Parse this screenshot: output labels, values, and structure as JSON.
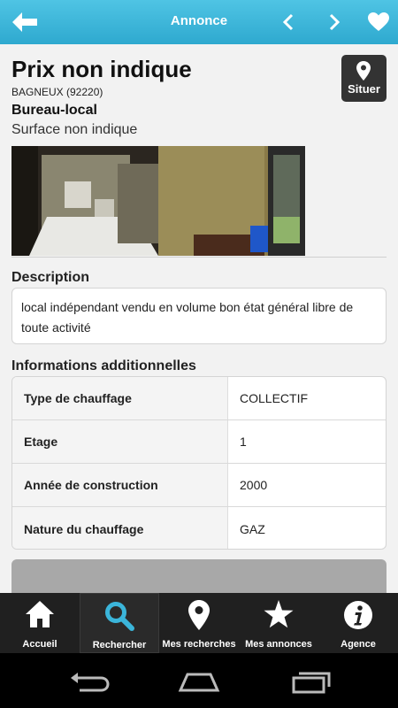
{
  "header": {
    "title": "Annonce",
    "back_icon": "back-arrow-icon",
    "prev_icon": "chevron-left-icon",
    "next_icon": "chevron-right-icon",
    "favorite_icon": "heart-icon"
  },
  "listing": {
    "price": "Prix non indique",
    "location": "BAGNEUX (92220)",
    "property_type": "Bureau-local",
    "surface": "Surface non indique",
    "locate_button_label": "Situer"
  },
  "description": {
    "title": "Description",
    "text": "local indépendant vendu en volume bon état général libre de toute activité"
  },
  "additional_info": {
    "title": "Informations additionnelles",
    "rows": [
      {
        "label": "Type de chauffage",
        "value": "COLLECTIF"
      },
      {
        "label": "Etage",
        "value": "1"
      },
      {
        "label": "Année de construction",
        "value": "2000"
      },
      {
        "label": "Nature du chauffage",
        "value": "GAZ"
      }
    ]
  },
  "tabs": [
    {
      "label": "Accueil",
      "icon": "home-icon",
      "active": false
    },
    {
      "label": "Rechercher",
      "icon": "search-icon",
      "active": true
    },
    {
      "label": "Mes recherches",
      "icon": "map-pin-icon",
      "active": false
    },
    {
      "label": "Mes annonces",
      "icon": "star-icon",
      "active": false
    },
    {
      "label": "Agence",
      "icon": "info-icon",
      "active": false
    }
  ],
  "colors": {
    "header_bar": "#3bb5da",
    "tab_bar": "#202020"
  }
}
